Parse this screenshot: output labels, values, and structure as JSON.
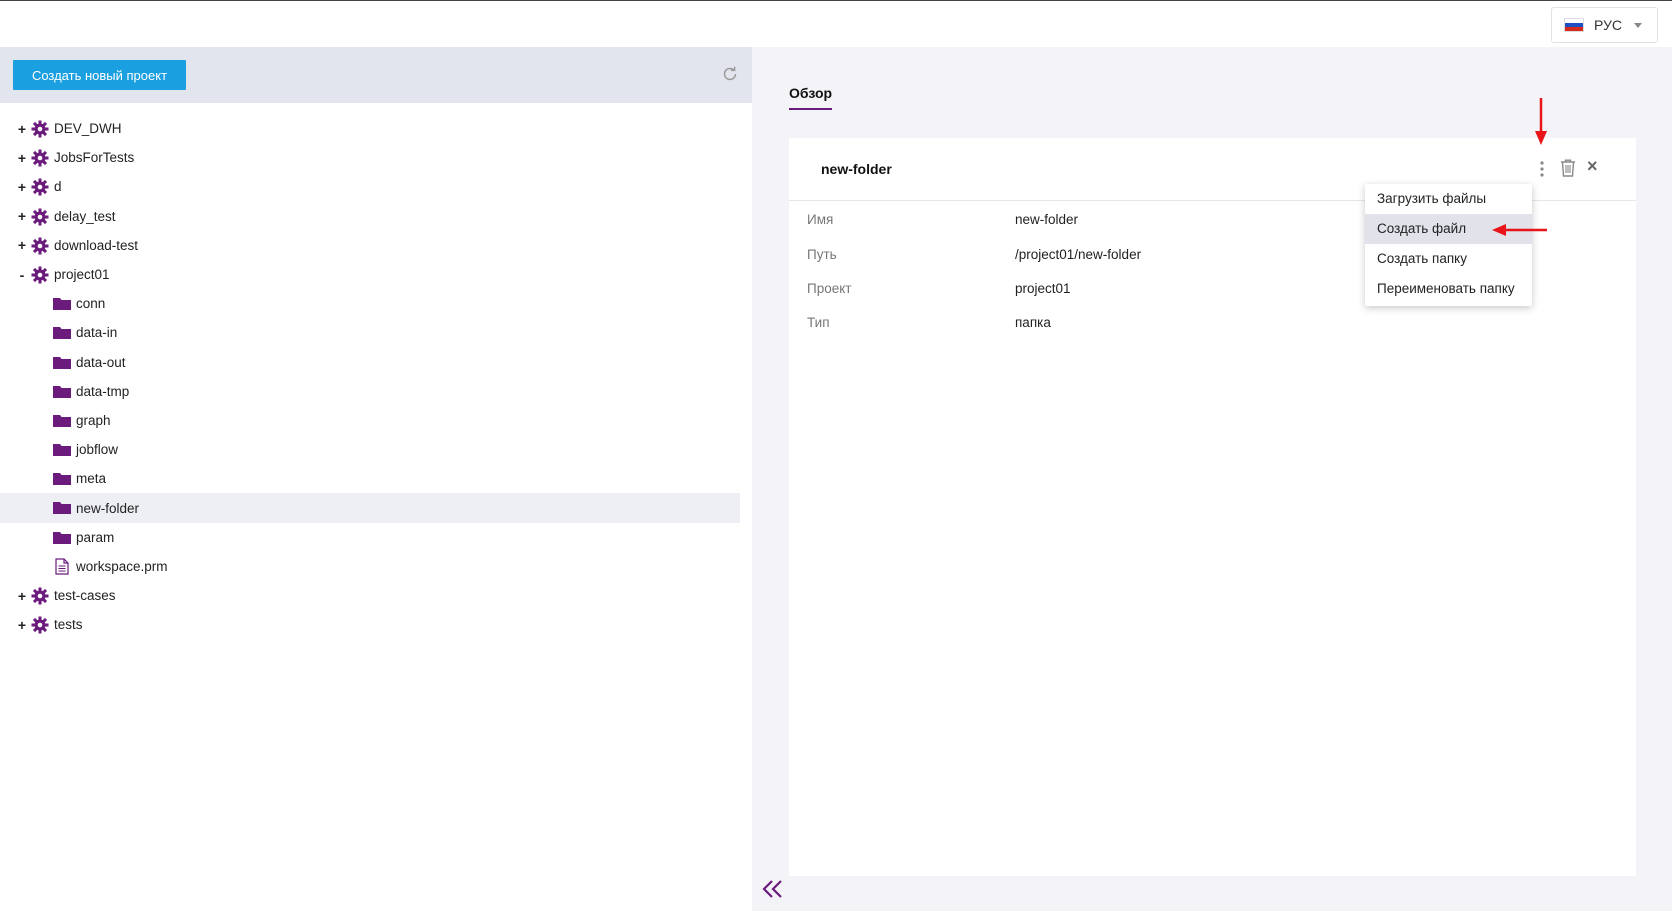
{
  "header": {
    "language": "РУС",
    "flag_colors": [
      "#ffffff",
      "#1f4fc4",
      "#d52b1e"
    ]
  },
  "sidebar": {
    "new_project_label": "Создать новый проект",
    "projects": [
      {
        "name": "DEV_DWH",
        "toggle": "+"
      },
      {
        "name": "JobsForTests",
        "toggle": "+"
      },
      {
        "name": "d",
        "toggle": "+"
      },
      {
        "name": "delay_test",
        "toggle": "+"
      },
      {
        "name": "download-test",
        "toggle": "+"
      },
      {
        "name": "project01",
        "toggle": "-"
      }
    ],
    "project01_children": [
      {
        "name": "conn",
        "type": "folder"
      },
      {
        "name": "data-in",
        "type": "folder"
      },
      {
        "name": "data-out",
        "type": "folder"
      },
      {
        "name": "data-tmp",
        "type": "folder"
      },
      {
        "name": "graph",
        "type": "folder"
      },
      {
        "name": "jobflow",
        "type": "folder"
      },
      {
        "name": "meta",
        "type": "folder"
      },
      {
        "name": "new-folder",
        "type": "folder",
        "selected": true
      },
      {
        "name": "param",
        "type": "folder"
      },
      {
        "name": "workspace.prm",
        "type": "file"
      }
    ],
    "projects_after": [
      {
        "name": "test-cases",
        "toggle": "+"
      },
      {
        "name": "tests",
        "toggle": "+"
      }
    ]
  },
  "main": {
    "tab_label": "Обзор",
    "card_title": "new-folder",
    "properties": [
      {
        "key": "Имя",
        "value": "new-folder"
      },
      {
        "key": "Путь",
        "value": "/project01/new-folder"
      },
      {
        "key": "Проект",
        "value": "project01"
      },
      {
        "key": "Тип",
        "value": "папка"
      }
    ]
  },
  "context_menu": {
    "items": [
      {
        "label": "Загрузить файлы"
      },
      {
        "label": "Создать файл",
        "highlighted": true
      },
      {
        "label": "Создать папку"
      },
      {
        "label": "Переименовать папку"
      }
    ]
  },
  "colors": {
    "accent_purple": "#6a1b7c",
    "button_blue": "#1a9fe0",
    "annotation_red": "#e8141a"
  }
}
